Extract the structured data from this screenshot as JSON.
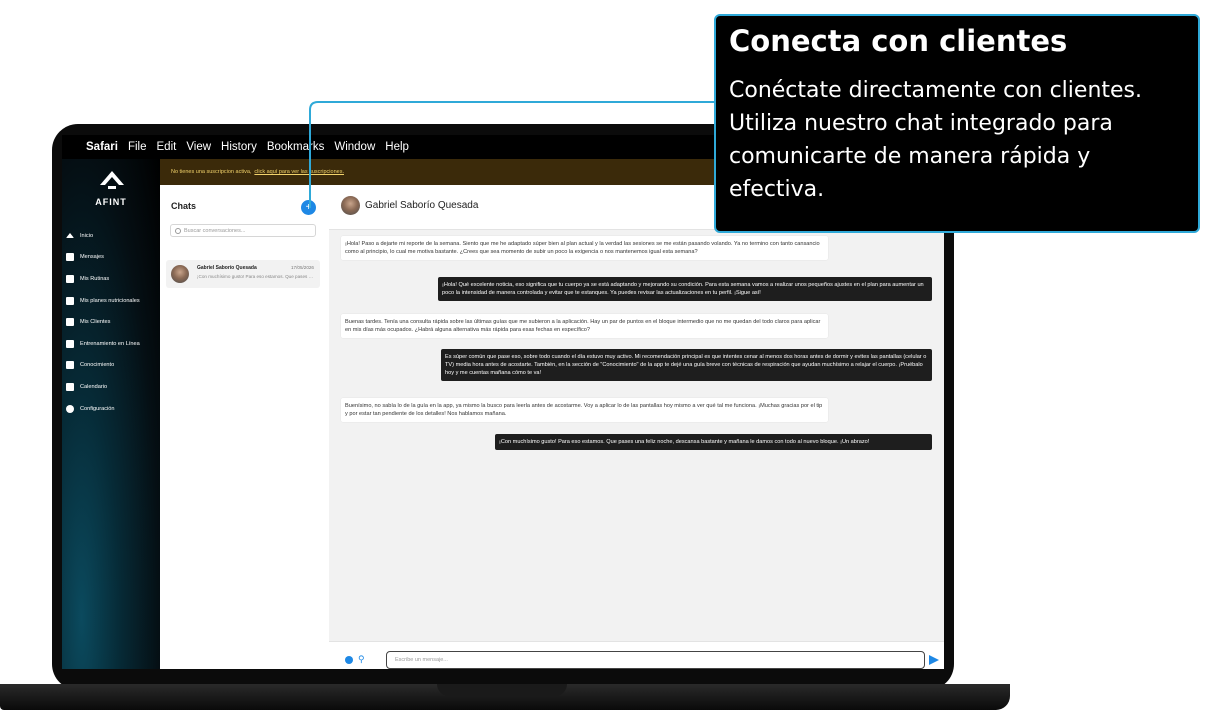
{
  "menubar": {
    "app": "Safari",
    "items": [
      "File",
      "Edit",
      "View",
      "History",
      "Bookmarks",
      "Window",
      "Help"
    ]
  },
  "sidebar": {
    "logo_text": "AFINT",
    "items": [
      {
        "label": "Inicio",
        "icon": "home-icon"
      },
      {
        "label": "Mensajes",
        "icon": "chat-icon"
      },
      {
        "label": "Mis Rutinas",
        "icon": "routines-icon"
      },
      {
        "label": "Mis planes nutricionales",
        "icon": "nutrition-icon"
      },
      {
        "label": "Mis Clientes",
        "icon": "clients-icon"
      },
      {
        "label": "Entrenamiento en Línea",
        "icon": "video-icon"
      },
      {
        "label": "Conocimiento",
        "icon": "book-icon"
      },
      {
        "label": "Calendario",
        "icon": "calendar-icon"
      },
      {
        "label": "Configuración",
        "icon": "gear-icon"
      }
    ]
  },
  "banner": {
    "text": "No tienes una suscripcion activa,",
    "link": "click aquí para ver las suscripciones."
  },
  "chats": {
    "title": "Chats",
    "new_button": "+",
    "search_placeholder": "Buscar conversaciones...",
    "conversations": [
      {
        "name": "Gabriel Saborío Quesada",
        "date": "17/05/2026",
        "preview": "¡Con muchísimo gusto! Para eso estamos. Que pases una feliz noche"
      }
    ]
  },
  "chat": {
    "contact": "Gabriel Saborío Quesada",
    "messages": [
      {
        "dir": "in",
        "text": "¡Hola! Paso a dejarte mi reporte de la semana. Siento que me he adaptado súper bien al plan actual y la verdad las sesiones se me están pasando volando. Ya no termino con tanto cansancio como al principio, lo cual me motiva bastante. ¿Crees que sea momento de subir un poco la exigencia o nos mantenemos igual esta semana?"
      },
      {
        "dir": "out",
        "text": "¡Hola! Qué excelente noticia, eso significa que tu cuerpo ya se está adaptando y mejorando su condición. Para esta semana vamos a realizar unos pequeños ajustes en el plan para aumentar un poco la intensidad de manera controlada y evitar que te estanques. Ya puedes revisar las actualizaciones en tu perfil. ¡Sigue así!"
      },
      {
        "dir": "in",
        "text": "Buenas tardes. Tenía una consulta rápida sobre las últimas guías que me subieron a la aplicación. Hay un par de puntos en el bloque intermedio que no me quedan del todo claros para aplicar en mis días más ocupados. ¿Habrá alguna alternativa más rápida para esas fechas en específico?"
      },
      {
        "dir": "out",
        "text": "Es súper común que pase eso, sobre todo cuando el día estuvo muy activo. Mi recomendación principal es que intentes cenar al menos dos horas antes de dormir y evites las pantallas (celular o TV) media hora antes de acostarte. También, en la sección de \"Conocimiento\" de la app te dejé una guía breve con técnicas de respiración que ayudan muchísimo a relajar el cuerpo. ¡Pruébalo hoy y me cuentas mañana cómo te va!"
      },
      {
        "dir": "in",
        "text": "Buenísimo, no sabía lo de la guía en la app, ya mismo la busco para leerla antes de acostarme. Voy a aplicar lo de las pantallas hoy mismo a ver qué tal me funciona. ¡Muchas gracias por el tip y por estar tan pendiente de los detalles! Nos hablamos mañana."
      },
      {
        "dir": "out",
        "text": "¡Con muchísimo gusto! Para eso estamos. Que pases una feliz noche, descansa bastante y mañana le damos con todo al nuevo bloque. ¡Un abrazo!"
      }
    ],
    "input_placeholder": "Escribe un mensaje..."
  },
  "callout": {
    "title": "Conecta con clientes",
    "body": "Conéctate directamente con clientes. Utiliza nuestro chat integrado para comunicarte de manera rápida y efectiva."
  },
  "colors": {
    "accent": "#1e88e5",
    "callout_border": "#2fa9d8",
    "banner_bg": "#3b2a0a",
    "banner_text": "#f2d36b"
  }
}
